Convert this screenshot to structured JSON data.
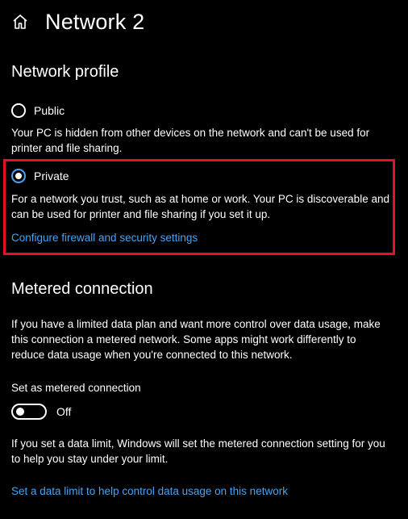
{
  "header": {
    "title": "Network 2",
    "home_icon": "home-icon"
  },
  "network_profile": {
    "title": "Network profile",
    "options": [
      {
        "label": "Public",
        "selected": false,
        "description": "Your PC is hidden from other devices on the network and can't be used for printer and file sharing."
      },
      {
        "label": "Private",
        "selected": true,
        "description": "For a network you trust, such as at home or work. Your PC is discoverable and can be used for printer and file sharing if you set it up."
      }
    ],
    "firewall_link": "Configure firewall and security settings"
  },
  "metered": {
    "title": "Metered connection",
    "description": "If you have a limited data plan and want more control over data usage, make this connection a metered network. Some apps might work differently to reduce data usage when you're connected to this network.",
    "toggle_label": "Set as metered connection",
    "toggle_state": "Off",
    "toggle_on": false,
    "data_limit_note": "If you set a data limit, Windows will set the metered connection setting for you to help you stay under your limit.",
    "data_limit_link": "Set a data limit to help control data usage on this network"
  },
  "colors": {
    "background": "#000000",
    "accent": "#4aa3f0",
    "highlight": "#e81123"
  }
}
